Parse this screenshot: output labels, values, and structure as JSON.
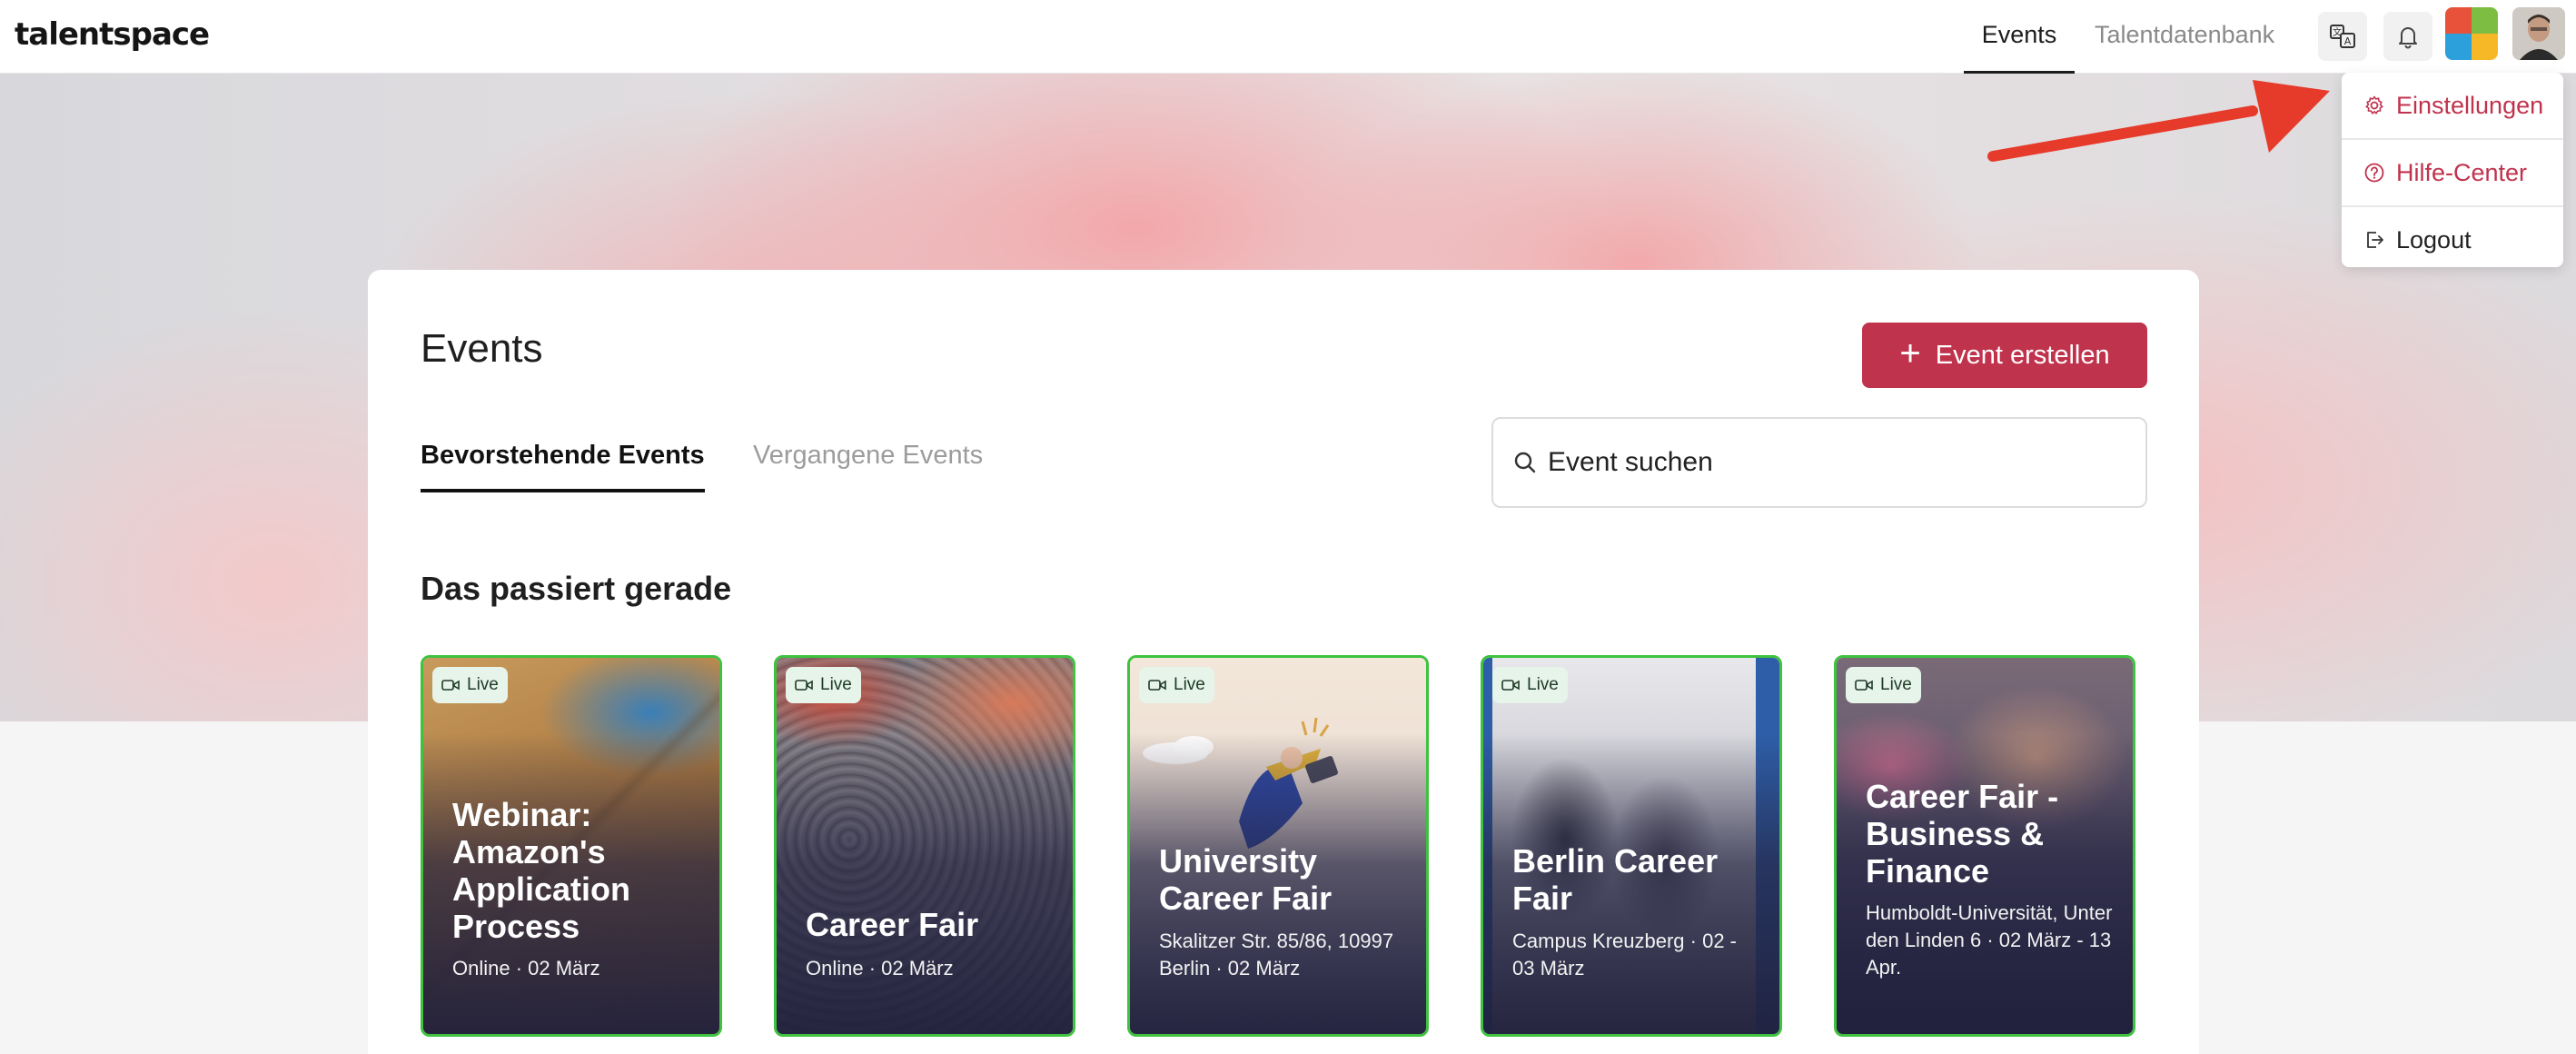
{
  "brand": {
    "name": "talentspace"
  },
  "nav": {
    "tabs": [
      {
        "label": "Events",
        "active": true
      },
      {
        "label": "Talentdatenbank",
        "active": false
      }
    ],
    "icons": [
      "translate-icon",
      "bell-icon"
    ]
  },
  "user_menu": {
    "items": [
      {
        "label": "Einstellungen",
        "icon": "gear-icon"
      },
      {
        "label": "Hilfe-Center",
        "icon": "question-circle-icon"
      },
      {
        "label": "Logout",
        "icon": "logout-icon"
      }
    ]
  },
  "page": {
    "title": "Events",
    "create_button": "Event erstellen",
    "tabs": [
      {
        "label": "Bevorstehende Events",
        "active": true
      },
      {
        "label": "Vergangene Events",
        "active": false
      }
    ],
    "search": {
      "placeholder": "Event suchen"
    },
    "section_title": "Das passiert gerade"
  },
  "events": [
    {
      "badge": "Live",
      "title": "Webinar: Amazon's Application Process",
      "subtitle": "Online · 02 März"
    },
    {
      "badge": "Live",
      "title": "Career Fair",
      "subtitle": "Online · 02 März"
    },
    {
      "badge": "Live",
      "title": "University Career Fair",
      "subtitle": "Skalitzer Str. 85/86, 10997 Berlin · 02 März"
    },
    {
      "badge": "Live",
      "title": "Berlin Career Fair",
      "subtitle": "Campus Kreuzberg · 02 - 03 März"
    },
    {
      "badge": "Live",
      "title": "Career Fair - Business & Finance",
      "subtitle": "Humboldt-Universität, Unter den Linden 6 · 02 März - 13 Apr."
    }
  ],
  "colors": {
    "accent": "#c0334d",
    "live_border": "#3fc23f",
    "annotation_arrow": "#e63a2a"
  }
}
